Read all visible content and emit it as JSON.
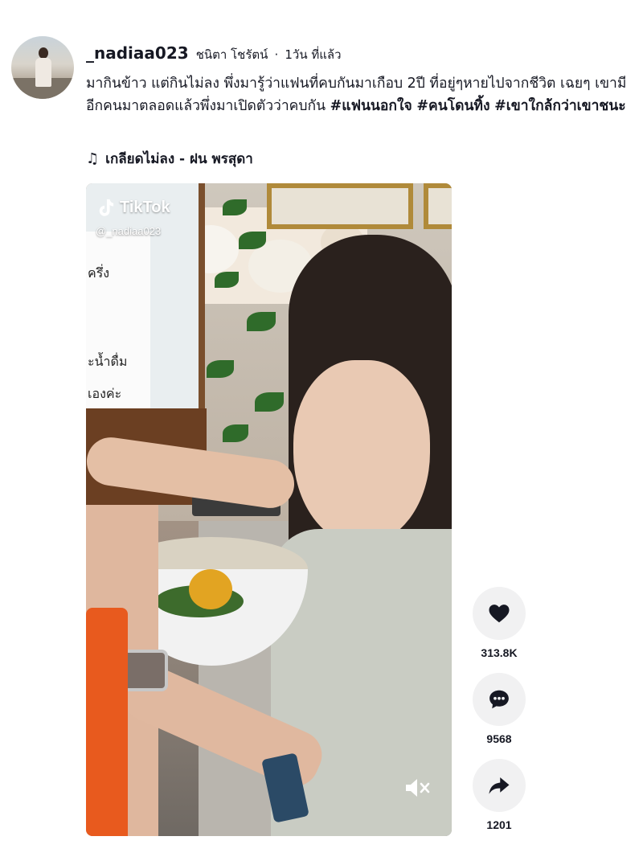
{
  "post": {
    "username": "_nadiaa023",
    "nickname": "ชนิตา โชรัตน์",
    "separator": "·",
    "time": "1วัน ที่แล้ว",
    "caption_text": "มากินข้าว แต่กินไม่ลง พึ่งมารู้ว่าแฟนที่คบกันมาเกือบ 2ปี ที่อยู่ๆหายไปจากชีวิต เฉยๆ เขามีอีกคนมาตลอดแล้วพึ่งมาเปิดตัวว่าคบกัน",
    "hashtags": [
      "#แฟนนอกใจ",
      "#คนโดนทิ้ง",
      "#เขาใกล้กว่าเขาชนะ"
    ],
    "music_icon": "music-note-icon",
    "music": "เกลียดไม่ลง - ฝน พรสุดา"
  },
  "video": {
    "watermark_brand": "TikTok",
    "watermark_handle": "@_nadiaa023",
    "sign_lines": [
      "ครึ่ง",
      "ะน้ำดื่ม",
      "เองค่ะ"
    ]
  },
  "actions": {
    "like_count": "313.8K",
    "comment_count": "9568",
    "share_count": "1201"
  }
}
